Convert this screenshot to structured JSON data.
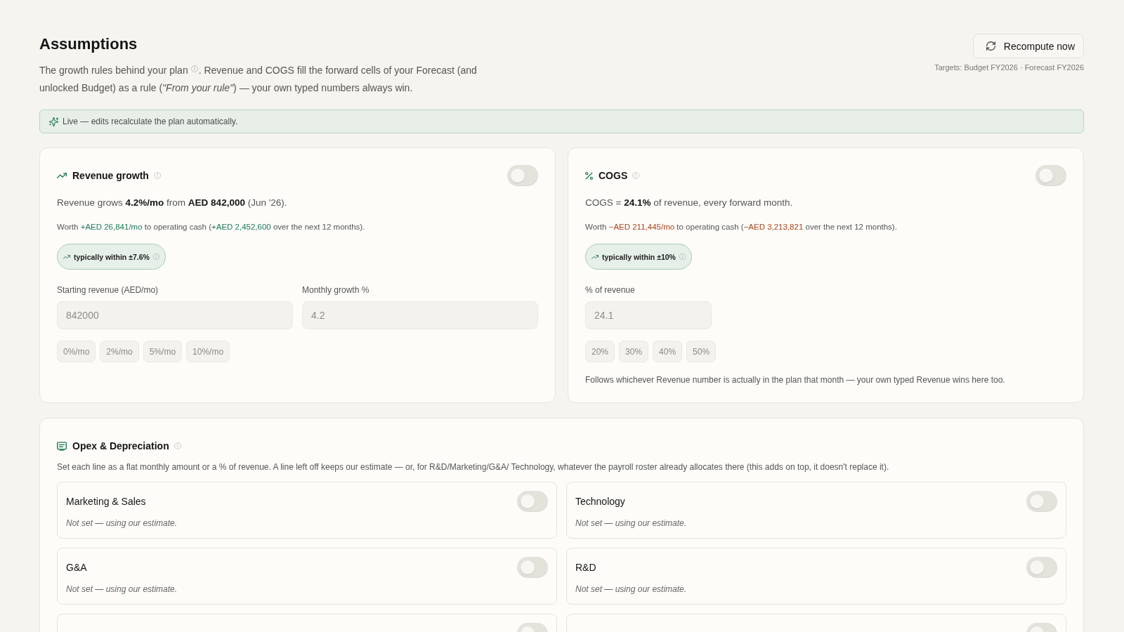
{
  "header": {
    "title": "Assumptions",
    "description_lead": "The growth rules behind your plan",
    "description_cont": ". Revenue and COGS fill the forward cells of your Forecast (and",
    "description_end": "unlocked Budget) as a rule (*\"From your rule\"*) — your own typed numbers always win.",
    "action": "Recompute now",
    "targets": "Targets: Budget FY2026 · Forecast FY2026"
  },
  "banner": {
    "text": "Live — edits recalculate the plan automatically."
  },
  "rules": [
    {
      "kind": "growth",
      "title": "Revenue growth",
      "on": false,
      "summary": "Revenue grows **4.2%/mo** from **AED 842,000** (Jun '26).",
      "impact": "Worth **+AED 26,841/mo** to operating cash (**+AED 2,452,600** over the next 12 months).",
      "impact_negative": false,
      "range": "typically within ±7.6%",
      "fields": [
        {
          "label": "Starting revenue (AED/mo)",
          "value": "842000",
          "disabled": true
        },
        {
          "label": "Monthly growth %",
          "value": "4.2",
          "disabled": true
        }
      ],
      "presets": [
        "0%/mo",
        "2%/mo",
        "5%/mo",
        "10%/mo"
      ]
    },
    {
      "kind": "percent",
      "title": "COGS",
      "on": false,
      "summary": "COGS = **24.1%** of revenue, every forward month.",
      "impact": "Worth **−AED 211,445/mo** to operating cash (**−AED 3,213,821** over the next 12 months).",
      "impact_negative": true,
      "range": "typically within ±10%",
      "fields": [
        {
          "label": "% of revenue",
          "value": "24.1",
          "disabled": true
        }
      ],
      "presets": [
        "20%",
        "30%",
        "40%",
        "50%"
      ],
      "note": "Follows whichever Revenue number is actually in the plan that month — your own typed Revenue wins here too."
    }
  ],
  "opex": {
    "title": "Opex & Depreciation",
    "description": "Set each line as a flat monthly amount or a % of revenue. A line left off keeps our estimate — or, for R&D/Marketing/G&A/ Technology, whatever the payroll roster already allocates there (this adds on top, it doesn't replace it).",
    "lines": [
      {
        "name": "Marketing & Sales",
        "on": false,
        "status": "Not set — using our estimate."
      },
      {
        "name": "Technology",
        "on": false,
        "status": "Not set — using our estimate."
      },
      {
        "name": "G&A",
        "on": false,
        "status": "Not set — using our estimate."
      },
      {
        "name": "R&D",
        "on": false,
        "status": "Not set — using our estimate."
      },
      {
        "on": false
      },
      {
        "on": false
      }
    ]
  }
}
